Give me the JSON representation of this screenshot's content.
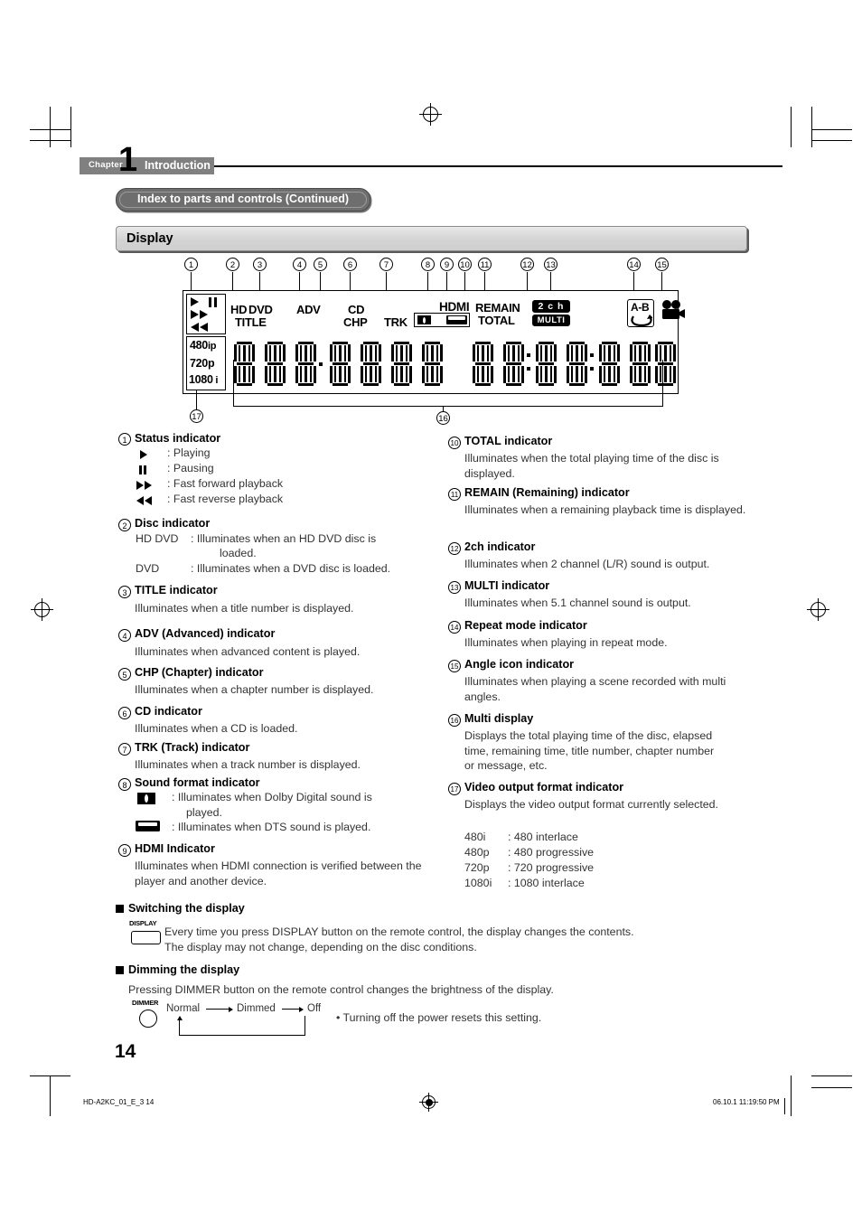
{
  "header": {
    "chapter_word": "Chapter",
    "chapter_number": "1",
    "chapter_title": "Introduction",
    "breadcrumb_pill": "Index to parts and controls (Continued)",
    "section_title": "Display"
  },
  "display_panel": {
    "callout_numbers": [
      "1",
      "2",
      "3",
      "4",
      "5",
      "6",
      "7",
      "8",
      "9",
      "10",
      "11",
      "12",
      "13",
      "14",
      "15",
      "16",
      "17"
    ],
    "labels": {
      "hd": "HD",
      "dvd": "DVD",
      "title": "TITLE",
      "adv": "ADV",
      "cd": "CD",
      "chp": "CHP",
      "trk": "TRK",
      "hdmi": "HDMI",
      "remain": "REMAIN",
      "total": "TOTAL",
      "two_ch": "2 c h",
      "multi": "MULTI",
      "ab_repeat": "A-B",
      "video_480i": "480",
      "video_480i_suffix": "i",
      "video_480p_suffix": "p",
      "video_720p": "720p",
      "video_1080i": "1080",
      "video_1080i_suffix": "i"
    }
  },
  "items": [
    {
      "num": "1",
      "title": "Status indicator",
      "sublines": [
        {
          "icon": "play-icon",
          "text": ": Playing"
        },
        {
          "icon": "pause-icon",
          "text": ": Pausing"
        },
        {
          "icon": "fast-forward-icon",
          "text": ": Fast forward playback"
        },
        {
          "icon": "fast-reverse-icon",
          "text": ": Fast reverse playback"
        }
      ]
    },
    {
      "num": "2",
      "title": "Disc indicator",
      "rows": [
        {
          "key": "HD DVD",
          "text": ": Illuminates when an HD DVD disc is"
        },
        {
          "key": "",
          "text": "loaded."
        },
        {
          "key": "DVD",
          "text": ": Illuminates when a DVD disc is loaded."
        }
      ]
    },
    {
      "num": "3",
      "title": "TITLE indicator",
      "body": "Illuminates when a title number is displayed."
    },
    {
      "num": "4",
      "title": "ADV (Advanced) indicator",
      "body": "Illuminates when advanced content is played."
    },
    {
      "num": "5",
      "title": "CHP (Chapter) indicator",
      "body": "Illuminates when a chapter number is displayed."
    },
    {
      "num": "6",
      "title": "CD indicator",
      "body": "Illuminates when a CD is loaded."
    },
    {
      "num": "7",
      "title": "TRK (Track) indicator",
      "body": "Illuminates when a track number is displayed."
    },
    {
      "num": "8",
      "title": "Sound format indicator",
      "sublines": [
        {
          "icon": "dolby-digital-icon",
          "text": ": Illuminates when Dolby Digital sound is"
        },
        {
          "icon": "",
          "text": "played."
        },
        {
          "icon": "dts-icon",
          "text": ": Illuminates when DTS sound is played."
        }
      ]
    },
    {
      "num": "9",
      "title": "HDMI Indicator",
      "body": "Illuminates when HDMI connection is verified between the player and another device."
    },
    {
      "num": "10",
      "title": "TOTAL indicator",
      "body": "Illuminates when the total playing time of the disc is displayed."
    },
    {
      "num": "11",
      "title": "REMAIN (Remaining) indicator",
      "body": "Illuminates when a remaining playback time is displayed."
    },
    {
      "num": "12",
      "title": "2ch indicator",
      "body": "Illuminates when 2 channel (L/R) sound is output."
    },
    {
      "num": "13",
      "title": "MULTI indicator",
      "body": "Illuminates when 5.1 channel sound is output."
    },
    {
      "num": "14",
      "title": "Repeat mode indicator",
      "body": "Illuminates when playing in repeat mode."
    },
    {
      "num": "15",
      "title": "Angle icon indicator",
      "body": "Illuminates when playing a scene recorded with multi angles."
    },
    {
      "num": "16",
      "title": "Multi display",
      "body": "Displays the total playing time of the disc, elapsed time, remaining time, title number, chapter number or message, etc."
    },
    {
      "num": "17",
      "title": "Video output format indicator",
      "body": "Displays the video output format currently selected.",
      "formats": [
        {
          "code": "480i",
          "desc": ": 480 interlace"
        },
        {
          "code": "480p",
          "desc": ": 480 progressive"
        },
        {
          "code": "720p",
          "desc": ": 720 progressive"
        },
        {
          "code": "1080i",
          "desc": ": 1080 interlace"
        }
      ]
    }
  ],
  "switching": {
    "title": "Switching the display",
    "button_label": "DISPLAY",
    "line1": "Every time you press DISPLAY button on the remote control, the display changes the contents.",
    "line2": "The display may not change, depending on the disc conditions."
  },
  "dimming": {
    "title": "Dimming the display",
    "button_label": "DIMMER",
    "intro": "Pressing DIMMER button on the remote control changes the brightness of the display.",
    "states": [
      "Normal",
      "Dimmed",
      "Off"
    ],
    "note": "• Turning off the power resets this setting."
  },
  "page_number": "14",
  "footer": {
    "left": "HD-A2KC_01_E_3   14",
    "right": "06.10.1   11:19:50 PM"
  }
}
